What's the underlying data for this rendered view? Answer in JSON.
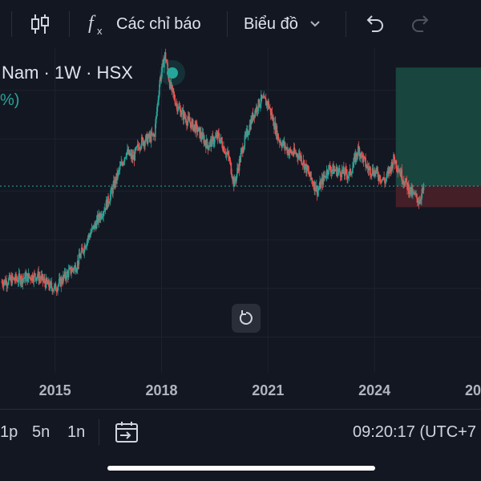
{
  "toolbar": {
    "indicators_label": "Các chỉ báo",
    "chart_type_label": "Biểu đồ"
  },
  "legend": {
    "symbol": "Nam · 1W · HSX",
    "percent": "%)"
  },
  "colors": {
    "up": "#26a69a",
    "down": "#ef5350",
    "background": "#131722",
    "grid": "#1e222d",
    "long_profit_zone": "#1b4d44",
    "long_stop_zone": "#4a2028"
  },
  "chart_data": {
    "type": "candlestick",
    "interval": "1W",
    "x_ticks": [
      "2015",
      "2018",
      "2021",
      "2024",
      "20"
    ],
    "path": [
      [
        2013.5,
        0.28
      ],
      [
        2014.0,
        0.29
      ],
      [
        2014.5,
        0.3
      ],
      [
        2014.8,
        0.27
      ],
      [
        2015.0,
        0.26
      ],
      [
        2015.3,
        0.3
      ],
      [
        2015.6,
        0.33
      ],
      [
        2015.9,
        0.41
      ],
      [
        2016.2,
        0.47
      ],
      [
        2016.5,
        0.53
      ],
      [
        2016.8,
        0.62
      ],
      [
        2017.0,
        0.68
      ],
      [
        2017.2,
        0.66
      ],
      [
        2017.4,
        0.71
      ],
      [
        2017.6,
        0.72
      ],
      [
        2017.8,
        0.73
      ],
      [
        2017.95,
        0.9
      ],
      [
        2018.1,
        0.98
      ],
      [
        2018.25,
        0.88
      ],
      [
        2018.45,
        0.82
      ],
      [
        2018.7,
        0.78
      ],
      [
        2019.0,
        0.75
      ],
      [
        2019.3,
        0.7
      ],
      [
        2019.6,
        0.73
      ],
      [
        2019.9,
        0.66
      ],
      [
        2020.05,
        0.58
      ],
      [
        2020.3,
        0.7
      ],
      [
        2020.6,
        0.8
      ],
      [
        2020.8,
        0.84
      ],
      [
        2021.0,
        0.83
      ],
      [
        2021.3,
        0.72
      ],
      [
        2021.6,
        0.68
      ],
      [
        2021.9,
        0.67
      ],
      [
        2022.2,
        0.6
      ],
      [
        2022.4,
        0.56
      ],
      [
        2022.7,
        0.63
      ],
      [
        2023.0,
        0.62
      ],
      [
        2023.3,
        0.61
      ],
      [
        2023.55,
        0.69
      ],
      [
        2023.8,
        0.63
      ],
      [
        2024.0,
        0.62
      ],
      [
        2024.3,
        0.59
      ],
      [
        2024.55,
        0.66
      ],
      [
        2024.8,
        0.6
      ],
      [
        2025.0,
        0.56
      ],
      [
        2025.25,
        0.53
      ],
      [
        2025.4,
        0.57
      ]
    ],
    "current_price_level": 0.575,
    "long_position": {
      "from": 2024.6,
      "target": 0.94,
      "entry": 0.575,
      "stop": 0.51
    },
    "x_range": [
      2013.45,
      2027.0
    ],
    "grid": true
  },
  "bottom": {
    "range_1": "1p",
    "range_2": "5n",
    "range_3": "1n",
    "clock": "09:20:17 (UTC+7"
  }
}
